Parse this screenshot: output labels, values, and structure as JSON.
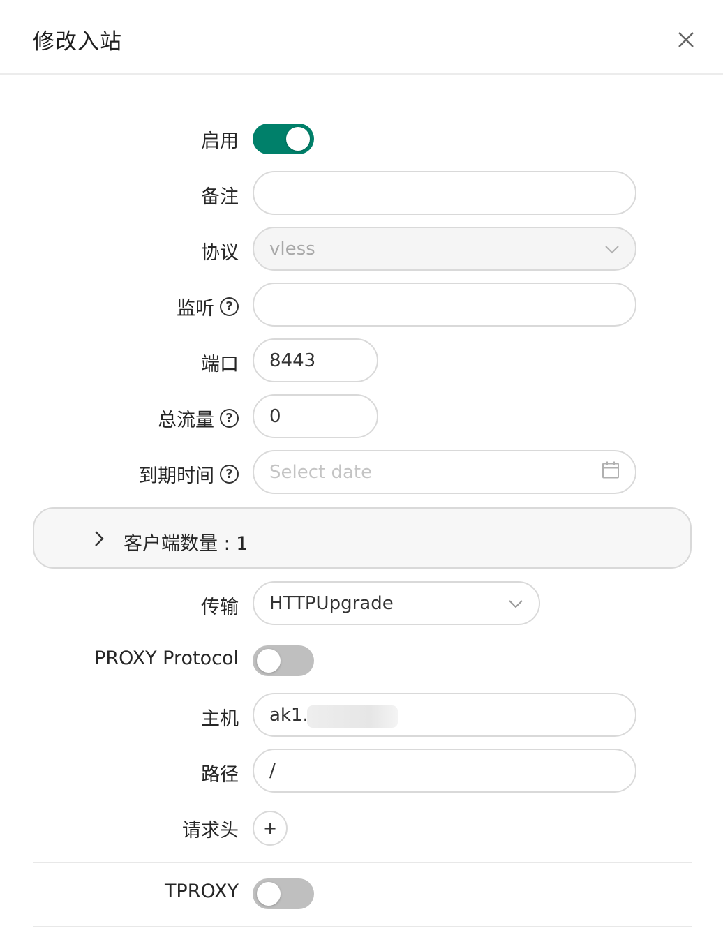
{
  "dialog": {
    "title": "修改入站"
  },
  "form": {
    "enable": {
      "label": "启用",
      "checked": true
    },
    "remark": {
      "label": "备注",
      "value": ""
    },
    "protocol": {
      "label": "协议",
      "value": "vless"
    },
    "listen": {
      "label": "监听",
      "value": ""
    },
    "port": {
      "label": "端口",
      "value": "8443"
    },
    "total_traffic": {
      "label": "总流量",
      "value": "0"
    },
    "expiry": {
      "label": "到期时间",
      "placeholder": "Select date"
    },
    "clients": {
      "label": "客户端数量 : 1"
    },
    "transport": {
      "label": "传输",
      "value": "HTTPUpgrade"
    },
    "proxy_protocol": {
      "label": "PROXY Protocol",
      "checked": false
    },
    "host": {
      "label": "主机",
      "value": "ak1.r"
    },
    "path": {
      "label": "路径",
      "value": "/"
    },
    "request_header": {
      "label": "请求头",
      "add_label": "+"
    },
    "tproxy": {
      "label": "TPROXY",
      "checked": false
    }
  },
  "colors": {
    "accent": "#00806a",
    "toggle_off": "#bfbfbf",
    "border": "#d9d9d9"
  },
  "icons": {
    "close": "close-icon",
    "help": "question-circle-icon",
    "dropdown": "chevron-down-icon",
    "calendar": "calendar-icon",
    "expand": "chevron-right-icon"
  }
}
